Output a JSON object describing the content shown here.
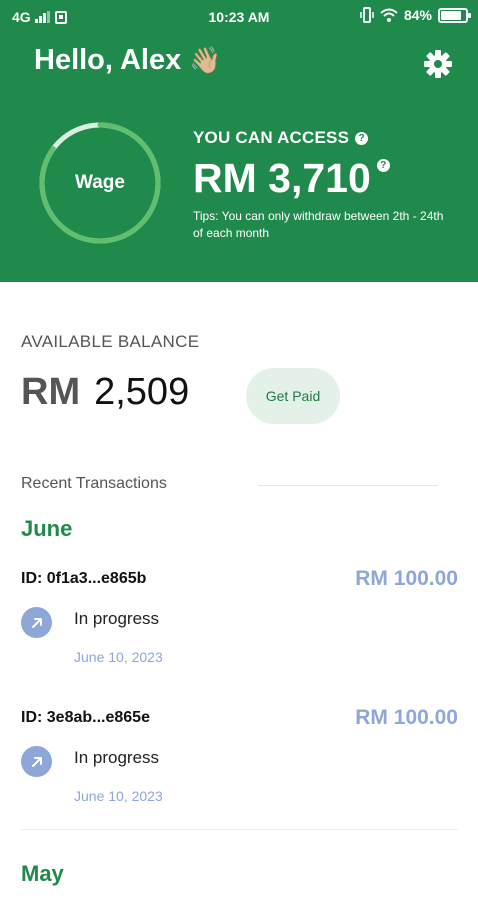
{
  "status_bar": {
    "network": "4G",
    "time": "10:23 AM",
    "battery_text": "84%",
    "battery_level": 0.84
  },
  "header": {
    "greeting": "Hello, Alex",
    "greeting_emoji": "👋🏼",
    "wage_label": "Wage",
    "wage_progress": 0.85,
    "access_title": "YOU CAN ACCESS",
    "access_amount": "RM 3,710",
    "help_glyph": "?",
    "tips": "Tips: You can only withdraw between 2th - 24th of each month"
  },
  "balance": {
    "label": "AVAILABLE BALANCE",
    "currency": "RM",
    "value": "2,509",
    "action_label": "Get Paid"
  },
  "recent_label": "Recent Transactions",
  "months": [
    "June",
    "May"
  ],
  "transactions": [
    {
      "id": "ID: 0f1a3...e865b",
      "amount": "RM 100.00",
      "status": "In progress",
      "date": "June 10, 2023"
    },
    {
      "id": "ID: 3e8ab...e865e",
      "amount": "RM 100.00",
      "status": "In progress",
      "date": "June 10, 2023"
    }
  ],
  "colors": {
    "brand_green": "#1f8a4c",
    "ring_green": "#5fbf6c",
    "pending_blue": "#8fa6d8"
  },
  "icons": [
    "signal-icon",
    "wifi-icon",
    "battery-icon",
    "gear-icon",
    "arrow-up-right-icon",
    "help-icon"
  ]
}
